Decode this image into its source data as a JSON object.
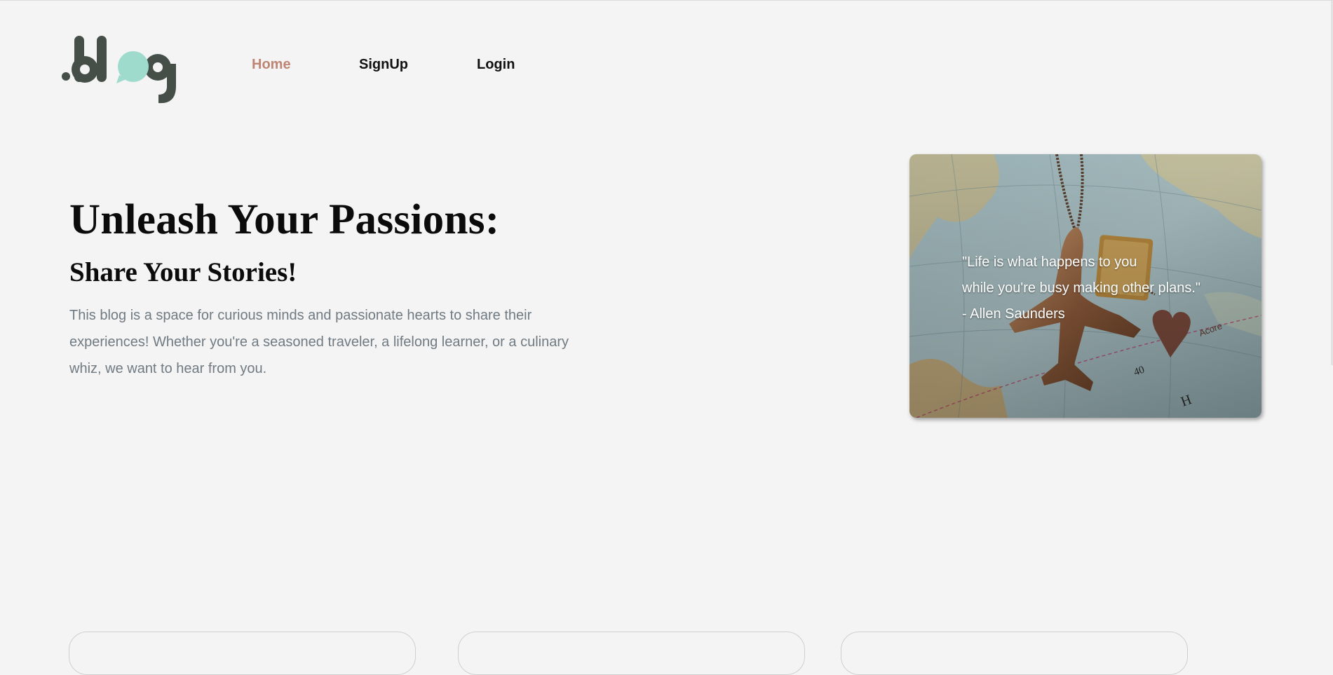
{
  "brand": {
    "logo_text": ".blog",
    "accent": "#9fdbcd",
    "logo_color": "#454f48"
  },
  "nav": {
    "items": [
      {
        "label": "Home",
        "active": true
      },
      {
        "label": "SignUp",
        "active": false
      },
      {
        "label": "Login",
        "active": false
      }
    ],
    "active_color": "#bf8574"
  },
  "hero": {
    "title": "Unleash Your Passions:",
    "subtitle": "Share Your Stories!",
    "description": "This blog is a space for curious minds and passionate hearts to share their experiences! Whether you're a seasoned traveler, a lifelong learner, or a culinary whiz, we want to hear from you."
  },
  "feature_card": {
    "image_icon": "travel-map-airplane-passport-photo",
    "quote_line1": "\"Life is what happens to you",
    "quote_line2": "while you're busy making other plans.\"",
    "quote_author": "- Allen Saunders"
  }
}
